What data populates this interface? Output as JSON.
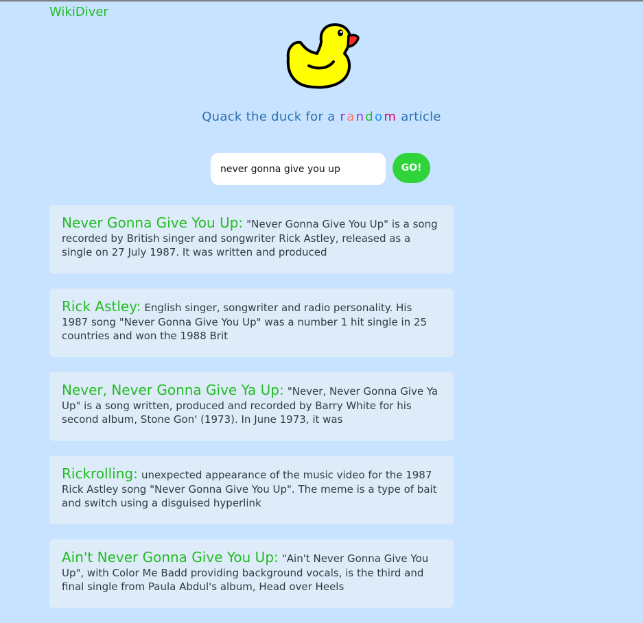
{
  "header": {
    "brand": "WikiDiver"
  },
  "hero": {
    "duck_icon": "rubber-duck-icon",
    "tagline_before": "Quack the duck for a",
    "random_letters": [
      "r",
      "a",
      "n",
      "d",
      "o",
      "m"
    ],
    "random_colors": [
      "#8a2be2",
      "#ff6f6f",
      "#a020f0",
      "#22bb22",
      "#1e90ff",
      "#e0006a"
    ],
    "tagline_after": "article"
  },
  "search": {
    "value": "never gonna give you up",
    "button_label": "GO!"
  },
  "results": [
    {
      "title": "Never Gonna Give You Up:",
      "snippet": "\"Never Gonna Give You Up\" is a song recorded by British singer and songwriter Rick Astley, released as a single on 27 July 1987. It was written and produced"
    },
    {
      "title": "Rick Astley:",
      "snippet": "English singer, songwriter and radio personality. His 1987 song \"Never Gonna Give You Up\" was a number 1 hit single in 25 countries and won the 1988 Brit"
    },
    {
      "title": "Never, Never Gonna Give Ya Up:",
      "snippet": "\"Never, Never Gonna Give Ya Up\" is a song written, produced and recorded by Barry White for his second album, Stone Gon' (1973). In June 1973, it was"
    },
    {
      "title": "Rickrolling:",
      "snippet": "unexpected appearance of the music video for the 1987 Rick Astley song \"Never Gonna Give You Up\". The meme is a type of bait and switch using a disguised hyperlink"
    },
    {
      "title": "Ain't Never Gonna Give You Up:",
      "snippet": "\"Ain't Never Gonna Give You Up\", with Color Me Badd providing background vocals, is the third and final single from Paula Abdul's album, Head over Heels"
    }
  ]
}
